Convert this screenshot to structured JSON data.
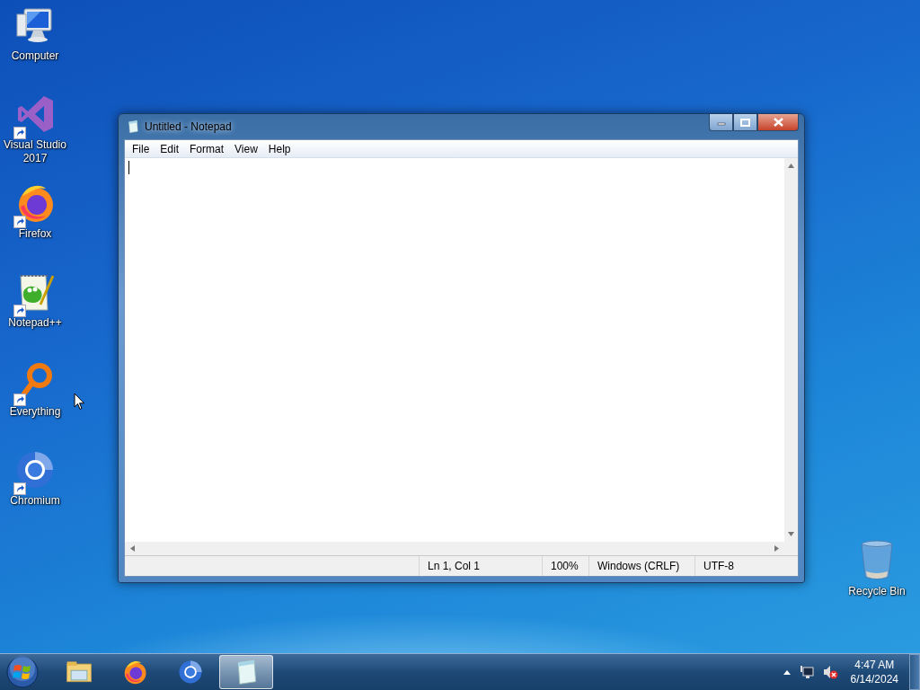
{
  "desktop_icons": [
    {
      "label": "Computer",
      "kind": "computer",
      "shortcut": false
    },
    {
      "label": "Visual Studio 2017",
      "kind": "visual-studio",
      "shortcut": true
    },
    {
      "label": "Firefox",
      "kind": "firefox",
      "shortcut": true
    },
    {
      "label": "Notepad++",
      "kind": "notepadpp",
      "shortcut": true
    },
    {
      "label": "Everything",
      "kind": "everything",
      "shortcut": true
    },
    {
      "label": "Chromium",
      "kind": "chromium",
      "shortcut": true
    }
  ],
  "recycle_bin": {
    "label": "Recycle Bin"
  },
  "window": {
    "title": "Untitled - Notepad",
    "menu": [
      "File",
      "Edit",
      "Format",
      "View",
      "Help"
    ],
    "status_bar": [
      "Ln 1, Col 1",
      "100%",
      "Windows (CRLF)",
      "UTF-8"
    ]
  },
  "taskbar": {
    "items": [
      {
        "kind": "explorer",
        "active": false
      },
      {
        "kind": "firefox",
        "active": false
      },
      {
        "kind": "chromium",
        "active": false
      },
      {
        "kind": "notepad",
        "active": true
      }
    ],
    "clock": {
      "time": "4:47 AM",
      "date": "6/14/2024"
    }
  }
}
